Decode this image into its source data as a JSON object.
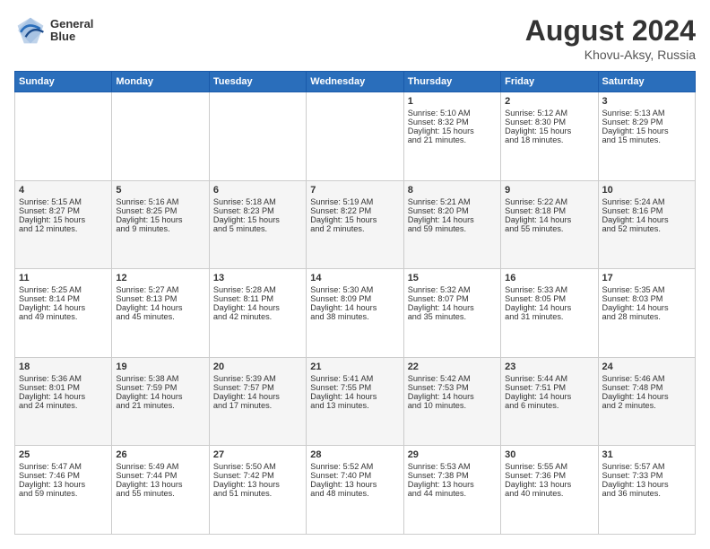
{
  "header": {
    "logo_line1": "General",
    "logo_line2": "Blue",
    "month_year": "August 2024",
    "location": "Khovu-Aksy, Russia"
  },
  "weekdays": [
    "Sunday",
    "Monday",
    "Tuesday",
    "Wednesday",
    "Thursday",
    "Friday",
    "Saturday"
  ],
  "weeks": [
    [
      {
        "day": "",
        "content": ""
      },
      {
        "day": "",
        "content": ""
      },
      {
        "day": "",
        "content": ""
      },
      {
        "day": "",
        "content": ""
      },
      {
        "day": "1",
        "content": "Sunrise: 5:10 AM\nSunset: 8:32 PM\nDaylight: 15 hours\nand 21 minutes."
      },
      {
        "day": "2",
        "content": "Sunrise: 5:12 AM\nSunset: 8:30 PM\nDaylight: 15 hours\nand 18 minutes."
      },
      {
        "day": "3",
        "content": "Sunrise: 5:13 AM\nSunset: 8:29 PM\nDaylight: 15 hours\nand 15 minutes."
      }
    ],
    [
      {
        "day": "4",
        "content": "Sunrise: 5:15 AM\nSunset: 8:27 PM\nDaylight: 15 hours\nand 12 minutes."
      },
      {
        "day": "5",
        "content": "Sunrise: 5:16 AM\nSunset: 8:25 PM\nDaylight: 15 hours\nand 9 minutes."
      },
      {
        "day": "6",
        "content": "Sunrise: 5:18 AM\nSunset: 8:23 PM\nDaylight: 15 hours\nand 5 minutes."
      },
      {
        "day": "7",
        "content": "Sunrise: 5:19 AM\nSunset: 8:22 PM\nDaylight: 15 hours\nand 2 minutes."
      },
      {
        "day": "8",
        "content": "Sunrise: 5:21 AM\nSunset: 8:20 PM\nDaylight: 14 hours\nand 59 minutes."
      },
      {
        "day": "9",
        "content": "Sunrise: 5:22 AM\nSunset: 8:18 PM\nDaylight: 14 hours\nand 55 minutes."
      },
      {
        "day": "10",
        "content": "Sunrise: 5:24 AM\nSunset: 8:16 PM\nDaylight: 14 hours\nand 52 minutes."
      }
    ],
    [
      {
        "day": "11",
        "content": "Sunrise: 5:25 AM\nSunset: 8:14 PM\nDaylight: 14 hours\nand 49 minutes."
      },
      {
        "day": "12",
        "content": "Sunrise: 5:27 AM\nSunset: 8:13 PM\nDaylight: 14 hours\nand 45 minutes."
      },
      {
        "day": "13",
        "content": "Sunrise: 5:28 AM\nSunset: 8:11 PM\nDaylight: 14 hours\nand 42 minutes."
      },
      {
        "day": "14",
        "content": "Sunrise: 5:30 AM\nSunset: 8:09 PM\nDaylight: 14 hours\nand 38 minutes."
      },
      {
        "day": "15",
        "content": "Sunrise: 5:32 AM\nSunset: 8:07 PM\nDaylight: 14 hours\nand 35 minutes."
      },
      {
        "day": "16",
        "content": "Sunrise: 5:33 AM\nSunset: 8:05 PM\nDaylight: 14 hours\nand 31 minutes."
      },
      {
        "day": "17",
        "content": "Sunrise: 5:35 AM\nSunset: 8:03 PM\nDaylight: 14 hours\nand 28 minutes."
      }
    ],
    [
      {
        "day": "18",
        "content": "Sunrise: 5:36 AM\nSunset: 8:01 PM\nDaylight: 14 hours\nand 24 minutes."
      },
      {
        "day": "19",
        "content": "Sunrise: 5:38 AM\nSunset: 7:59 PM\nDaylight: 14 hours\nand 21 minutes."
      },
      {
        "day": "20",
        "content": "Sunrise: 5:39 AM\nSunset: 7:57 PM\nDaylight: 14 hours\nand 17 minutes."
      },
      {
        "day": "21",
        "content": "Sunrise: 5:41 AM\nSunset: 7:55 PM\nDaylight: 14 hours\nand 13 minutes."
      },
      {
        "day": "22",
        "content": "Sunrise: 5:42 AM\nSunset: 7:53 PM\nDaylight: 14 hours\nand 10 minutes."
      },
      {
        "day": "23",
        "content": "Sunrise: 5:44 AM\nSunset: 7:51 PM\nDaylight: 14 hours\nand 6 minutes."
      },
      {
        "day": "24",
        "content": "Sunrise: 5:46 AM\nSunset: 7:48 PM\nDaylight: 14 hours\nand 2 minutes."
      }
    ],
    [
      {
        "day": "25",
        "content": "Sunrise: 5:47 AM\nSunset: 7:46 PM\nDaylight: 13 hours\nand 59 minutes."
      },
      {
        "day": "26",
        "content": "Sunrise: 5:49 AM\nSunset: 7:44 PM\nDaylight: 13 hours\nand 55 minutes."
      },
      {
        "day": "27",
        "content": "Sunrise: 5:50 AM\nSunset: 7:42 PM\nDaylight: 13 hours\nand 51 minutes."
      },
      {
        "day": "28",
        "content": "Sunrise: 5:52 AM\nSunset: 7:40 PM\nDaylight: 13 hours\nand 48 minutes."
      },
      {
        "day": "29",
        "content": "Sunrise: 5:53 AM\nSunset: 7:38 PM\nDaylight: 13 hours\nand 44 minutes."
      },
      {
        "day": "30",
        "content": "Sunrise: 5:55 AM\nSunset: 7:36 PM\nDaylight: 13 hours\nand 40 minutes."
      },
      {
        "day": "31",
        "content": "Sunrise: 5:57 AM\nSunset: 7:33 PM\nDaylight: 13 hours\nand 36 minutes."
      }
    ]
  ]
}
